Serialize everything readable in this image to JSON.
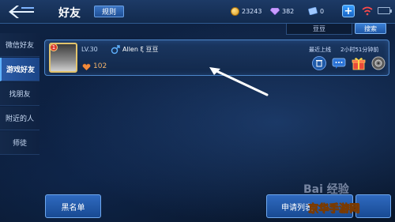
{
  "header": {
    "title": "好友",
    "rules_label": "规则",
    "gold": "23243",
    "diamonds": "382",
    "tickets": "0"
  },
  "search": {
    "value": "豆豆",
    "button_label": "搜索"
  },
  "sidebar": {
    "items": [
      {
        "label": "微信好友"
      },
      {
        "label": "游戏好友"
      },
      {
        "label": "找朋友"
      },
      {
        "label": "附近的人"
      },
      {
        "label": "师徒"
      }
    ],
    "active": "游戏好友"
  },
  "friend": {
    "rank": "1",
    "level": "LV.30",
    "name": "Allen ξ 豆豆",
    "intimacy": "102",
    "status_label": "最近上线",
    "status_time": "2小时51分钟前"
  },
  "bottom": {
    "blacklist_label": "黑名单",
    "requests_label": "申请列表"
  },
  "watermark": {
    "baidu": "Bai 经验",
    "site": "京华手游网"
  },
  "colors": {
    "accent": "#3a80d6",
    "panel_border": "#4d86c9",
    "active_tab": "#2a5ba8"
  }
}
